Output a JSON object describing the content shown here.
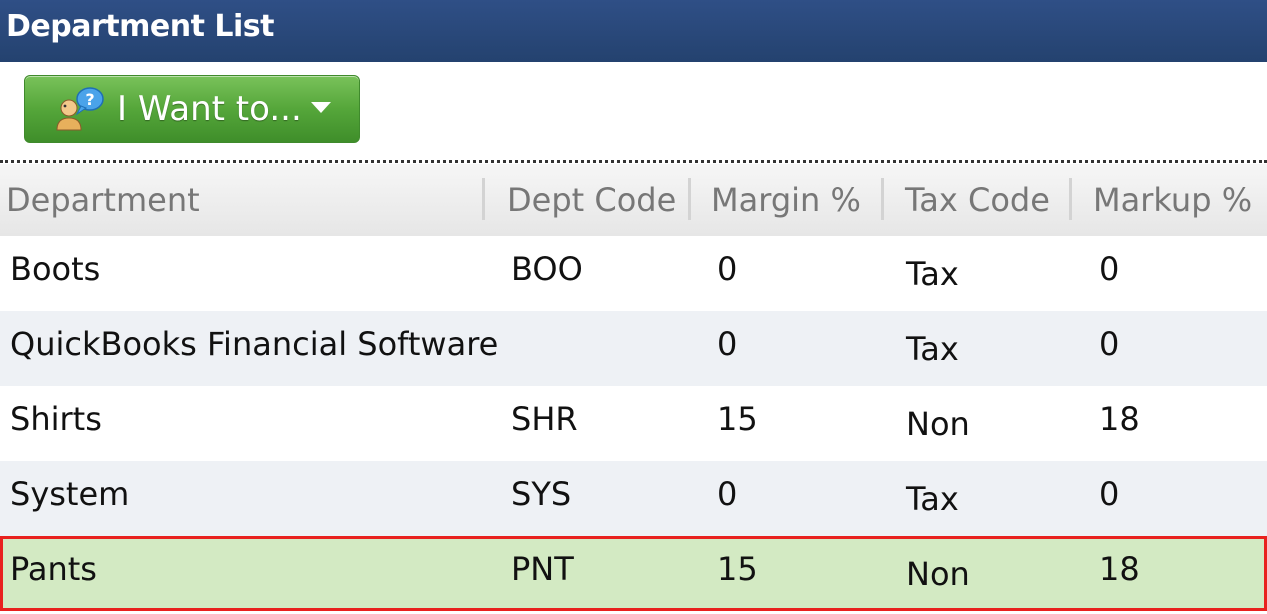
{
  "window": {
    "title": "Department List"
  },
  "toolbar": {
    "iwant_label": "I Want to...",
    "iwant_icon": "help-user-icon",
    "caret_icon": "caret-down-icon"
  },
  "colors": {
    "titlebar": "#2a4a7c",
    "button_green": "#55a63a",
    "selected_row": "#d3eac3",
    "selected_outline": "#e8211e"
  },
  "table": {
    "columns": [
      "Department",
      "Dept Code",
      "Margin %",
      "Tax Code",
      "Markup %"
    ],
    "rows": [
      [
        "Boots",
        "BOO",
        "0",
        "Tax",
        "0"
      ],
      [
        "QuickBooks Financial Software",
        "",
        "0",
        "Tax",
        "0"
      ],
      [
        "Shirts",
        "SHR",
        "15",
        "Non",
        "18"
      ],
      [
        "System",
        "SYS",
        "0",
        "Tax",
        "0"
      ],
      [
        "Pants",
        "PNT",
        "15",
        "Non",
        "18"
      ]
    ],
    "selected_row_index": 4
  }
}
